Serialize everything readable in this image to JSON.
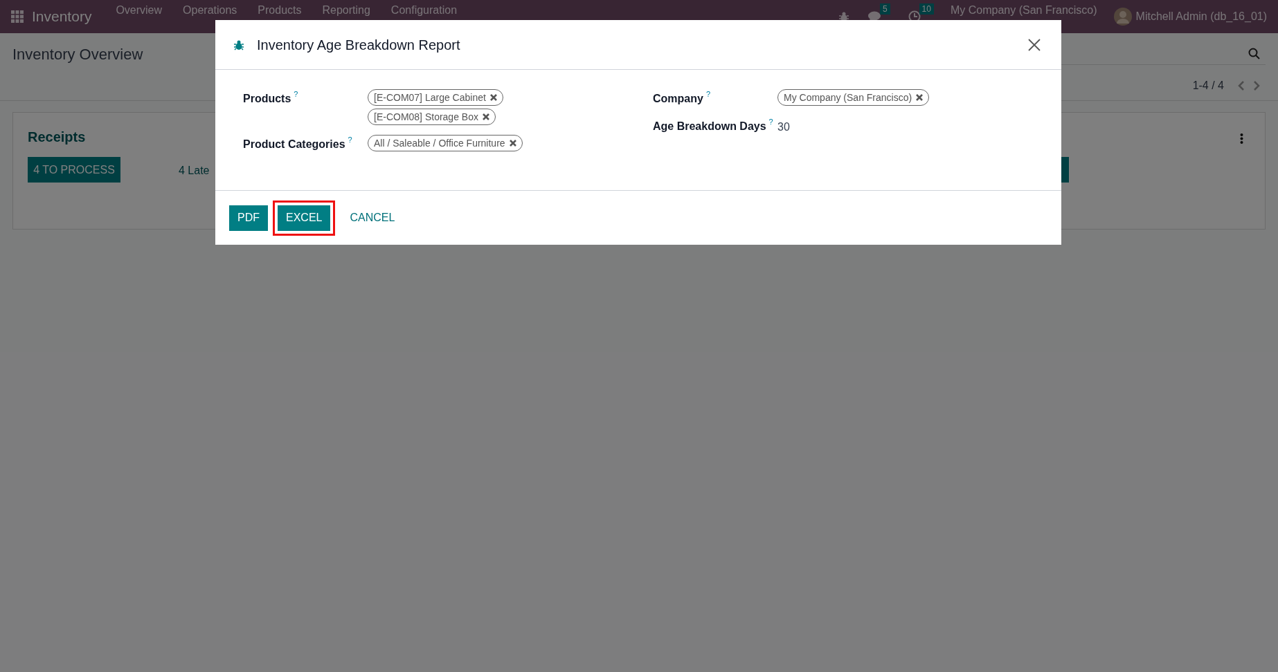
{
  "navbar": {
    "app_name": "Inventory",
    "menu": [
      "Overview",
      "Operations",
      "Products",
      "Reporting",
      "Configuration"
    ],
    "chat_badge": "5",
    "activity_badge": "10",
    "company": "My Company (San Francisco)",
    "user": "Mitchell Admin (db_16_01)"
  },
  "control_panel": {
    "title": "Inventory Overview",
    "pager": "1-4 / 4"
  },
  "card": {
    "title": "Receipts",
    "process_button": "4 TO PROCESS",
    "late": "4 Late"
  },
  "dialog": {
    "title": "Inventory Age Breakdown Report",
    "left_fields": [
      {
        "label": "Products",
        "help": "?",
        "kind": "tags",
        "tags": [
          "[E-COM07] Large Cabinet",
          "[E-COM08] Storage Box"
        ]
      },
      {
        "label": "Product Categories",
        "help": "?",
        "kind": "tags",
        "tags": [
          "All / Saleable / Office Furniture"
        ]
      }
    ],
    "right_fields": [
      {
        "label": "Company",
        "help": "?",
        "kind": "tags",
        "tags": [
          "My Company (San Francisco)"
        ]
      },
      {
        "label": "Age Breakdown Days",
        "help": "?",
        "kind": "text",
        "value": "30"
      }
    ],
    "buttons": [
      {
        "label": "PDF",
        "kind": "primary",
        "highlighted": false
      },
      {
        "label": "EXCEL",
        "kind": "primary",
        "highlighted": true
      },
      {
        "label": "CANCEL",
        "kind": "link",
        "highlighted": false
      }
    ]
  }
}
